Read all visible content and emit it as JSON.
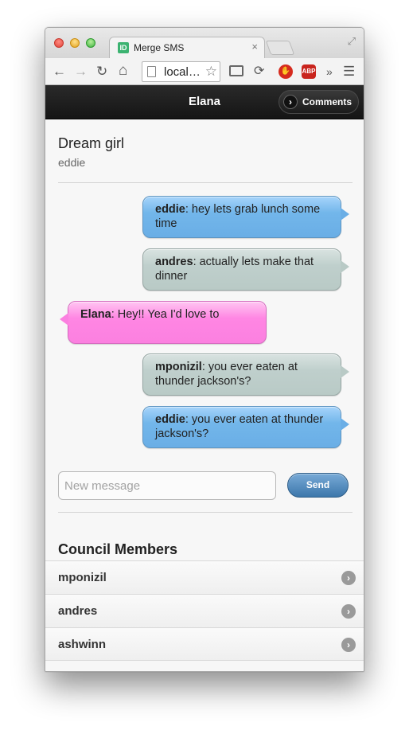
{
  "browser": {
    "tab_title": "Merge SMS",
    "tab_favicon": "ID",
    "tab_close": "×",
    "url": "local…",
    "icons": [
      "back-arrow-icon",
      "forward-arrow-icon",
      "reload-icon",
      "home-icon",
      "bookmark-star-icon",
      "cast-icon",
      "sync-icon",
      "stop-extension-icon",
      "adblock-icon",
      "overflow-icon",
      "menu-icon"
    ],
    "back": "←",
    "forward": "→",
    "reload": "↻",
    "home": "⌂",
    "star": "☆",
    "more": "»",
    "menu": "☰",
    "abp": "ABP"
  },
  "header": {
    "title": "Elana",
    "comments_label": "Comments",
    "comments_chevron": "›"
  },
  "thread": {
    "name": "Dream girl",
    "owner": "eddie"
  },
  "messages": [
    {
      "sender": "eddie",
      "text": ": hey lets grab lunch some time",
      "side": "right",
      "color": "#72b6ea"
    },
    {
      "sender": "andres",
      "text": ": actually lets make that dinner",
      "side": "right",
      "color": "#bfcfcc"
    },
    {
      "sender": "Elana",
      "text": ": Hey!! Yea I'd love to",
      "side": "left",
      "color": "#ff86e3"
    },
    {
      "sender": "mponizil",
      "text": ": you ever eaten at thunder jackson's?",
      "side": "right",
      "color": "#bfcfcc"
    },
    {
      "sender": "eddie",
      "text": ": you ever eaten at thunder jackson's?",
      "side": "right",
      "color": "#72b6ea"
    }
  ],
  "composer": {
    "placeholder": "New message",
    "value": "",
    "send_label": "Send"
  },
  "members": {
    "title": "Council Members",
    "items": [
      {
        "name": "mponizil",
        "arrow": "›"
      },
      {
        "name": "andres",
        "arrow": "›"
      },
      {
        "name": "ashwinn",
        "arrow": "›"
      }
    ]
  },
  "colors": {
    "header_bg": "#1a1a1a",
    "send_button": "#3d77ab",
    "bubble_blue": "#72b6ea",
    "bubble_gray": "#bfcfcc",
    "bubble_pink": "#ff86e3"
  }
}
